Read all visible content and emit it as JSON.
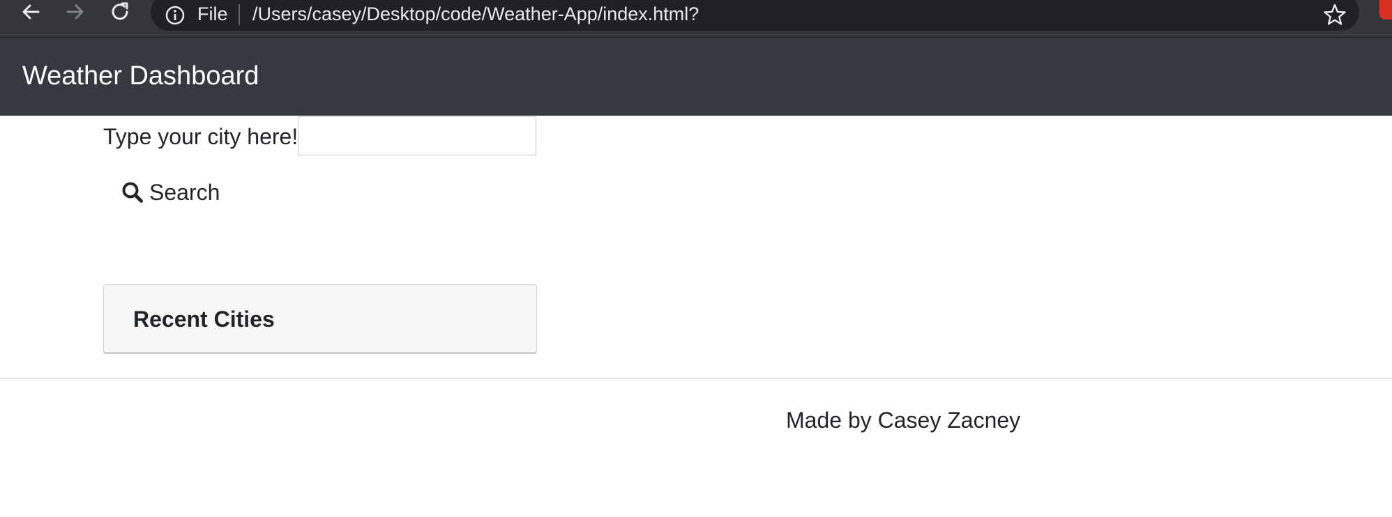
{
  "browser": {
    "file_label": "File",
    "url": "/Users/casey/Desktop/code/Weather-App/index.html?",
    "icons": [
      "back-arrow-icon",
      "forward-arrow-icon",
      "reload-icon",
      "info-icon",
      "star-icon",
      "extension-icon"
    ]
  },
  "navbar": {
    "brand": "Weather Dashboard",
    "background": "#343a40"
  },
  "search": {
    "label": "Type your city here!",
    "input_value": "",
    "button_label": "Search",
    "button_icon": "search-icon"
  },
  "recent": {
    "title": "Recent Cities",
    "items": []
  },
  "footer": {
    "text": "Made by Casey Zacney"
  }
}
